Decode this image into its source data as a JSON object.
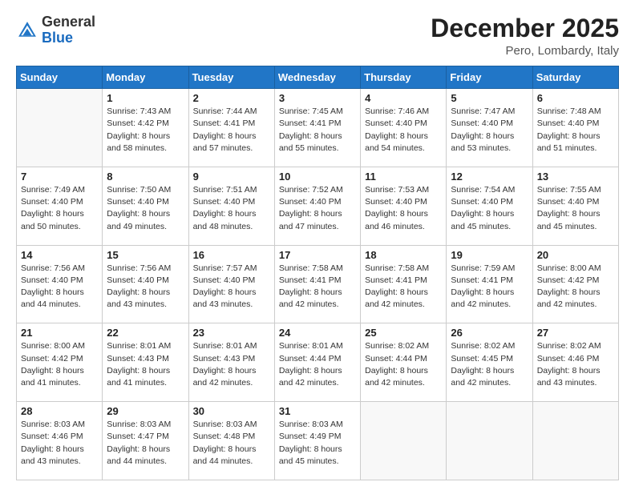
{
  "header": {
    "logo_general": "General",
    "logo_blue": "Blue",
    "month_title": "December 2025",
    "location": "Pero, Lombardy, Italy"
  },
  "weekdays": [
    "Sunday",
    "Monday",
    "Tuesday",
    "Wednesday",
    "Thursday",
    "Friday",
    "Saturday"
  ],
  "weeks": [
    [
      {
        "day": "",
        "sunrise": "",
        "sunset": "",
        "daylight": ""
      },
      {
        "day": "1",
        "sunrise": "Sunrise: 7:43 AM",
        "sunset": "Sunset: 4:42 PM",
        "daylight": "Daylight: 8 hours and 58 minutes."
      },
      {
        "day": "2",
        "sunrise": "Sunrise: 7:44 AM",
        "sunset": "Sunset: 4:41 PM",
        "daylight": "Daylight: 8 hours and 57 minutes."
      },
      {
        "day": "3",
        "sunrise": "Sunrise: 7:45 AM",
        "sunset": "Sunset: 4:41 PM",
        "daylight": "Daylight: 8 hours and 55 minutes."
      },
      {
        "day": "4",
        "sunrise": "Sunrise: 7:46 AM",
        "sunset": "Sunset: 4:40 PM",
        "daylight": "Daylight: 8 hours and 54 minutes."
      },
      {
        "day": "5",
        "sunrise": "Sunrise: 7:47 AM",
        "sunset": "Sunset: 4:40 PM",
        "daylight": "Daylight: 8 hours and 53 minutes."
      },
      {
        "day": "6",
        "sunrise": "Sunrise: 7:48 AM",
        "sunset": "Sunset: 4:40 PM",
        "daylight": "Daylight: 8 hours and 51 minutes."
      }
    ],
    [
      {
        "day": "7",
        "sunrise": "Sunrise: 7:49 AM",
        "sunset": "Sunset: 4:40 PM",
        "daylight": "Daylight: 8 hours and 50 minutes."
      },
      {
        "day": "8",
        "sunrise": "Sunrise: 7:50 AM",
        "sunset": "Sunset: 4:40 PM",
        "daylight": "Daylight: 8 hours and 49 minutes."
      },
      {
        "day": "9",
        "sunrise": "Sunrise: 7:51 AM",
        "sunset": "Sunset: 4:40 PM",
        "daylight": "Daylight: 8 hours and 48 minutes."
      },
      {
        "day": "10",
        "sunrise": "Sunrise: 7:52 AM",
        "sunset": "Sunset: 4:40 PM",
        "daylight": "Daylight: 8 hours and 47 minutes."
      },
      {
        "day": "11",
        "sunrise": "Sunrise: 7:53 AM",
        "sunset": "Sunset: 4:40 PM",
        "daylight": "Daylight: 8 hours and 46 minutes."
      },
      {
        "day": "12",
        "sunrise": "Sunrise: 7:54 AM",
        "sunset": "Sunset: 4:40 PM",
        "daylight": "Daylight: 8 hours and 45 minutes."
      },
      {
        "day": "13",
        "sunrise": "Sunrise: 7:55 AM",
        "sunset": "Sunset: 4:40 PM",
        "daylight": "Daylight: 8 hours and 45 minutes."
      }
    ],
    [
      {
        "day": "14",
        "sunrise": "Sunrise: 7:56 AM",
        "sunset": "Sunset: 4:40 PM",
        "daylight": "Daylight: 8 hours and 44 minutes."
      },
      {
        "day": "15",
        "sunrise": "Sunrise: 7:56 AM",
        "sunset": "Sunset: 4:40 PM",
        "daylight": "Daylight: 8 hours and 43 minutes."
      },
      {
        "day": "16",
        "sunrise": "Sunrise: 7:57 AM",
        "sunset": "Sunset: 4:40 PM",
        "daylight": "Daylight: 8 hours and 43 minutes."
      },
      {
        "day": "17",
        "sunrise": "Sunrise: 7:58 AM",
        "sunset": "Sunset: 4:41 PM",
        "daylight": "Daylight: 8 hours and 42 minutes."
      },
      {
        "day": "18",
        "sunrise": "Sunrise: 7:58 AM",
        "sunset": "Sunset: 4:41 PM",
        "daylight": "Daylight: 8 hours and 42 minutes."
      },
      {
        "day": "19",
        "sunrise": "Sunrise: 7:59 AM",
        "sunset": "Sunset: 4:41 PM",
        "daylight": "Daylight: 8 hours and 42 minutes."
      },
      {
        "day": "20",
        "sunrise": "Sunrise: 8:00 AM",
        "sunset": "Sunset: 4:42 PM",
        "daylight": "Daylight: 8 hours and 42 minutes."
      }
    ],
    [
      {
        "day": "21",
        "sunrise": "Sunrise: 8:00 AM",
        "sunset": "Sunset: 4:42 PM",
        "daylight": "Daylight: 8 hours and 41 minutes."
      },
      {
        "day": "22",
        "sunrise": "Sunrise: 8:01 AM",
        "sunset": "Sunset: 4:43 PM",
        "daylight": "Daylight: 8 hours and 41 minutes."
      },
      {
        "day": "23",
        "sunrise": "Sunrise: 8:01 AM",
        "sunset": "Sunset: 4:43 PM",
        "daylight": "Daylight: 8 hours and 42 minutes."
      },
      {
        "day": "24",
        "sunrise": "Sunrise: 8:01 AM",
        "sunset": "Sunset: 4:44 PM",
        "daylight": "Daylight: 8 hours and 42 minutes."
      },
      {
        "day": "25",
        "sunrise": "Sunrise: 8:02 AM",
        "sunset": "Sunset: 4:44 PM",
        "daylight": "Daylight: 8 hours and 42 minutes."
      },
      {
        "day": "26",
        "sunrise": "Sunrise: 8:02 AM",
        "sunset": "Sunset: 4:45 PM",
        "daylight": "Daylight: 8 hours and 42 minutes."
      },
      {
        "day": "27",
        "sunrise": "Sunrise: 8:02 AM",
        "sunset": "Sunset: 4:46 PM",
        "daylight": "Daylight: 8 hours and 43 minutes."
      }
    ],
    [
      {
        "day": "28",
        "sunrise": "Sunrise: 8:03 AM",
        "sunset": "Sunset: 4:46 PM",
        "daylight": "Daylight: 8 hours and 43 minutes."
      },
      {
        "day": "29",
        "sunrise": "Sunrise: 8:03 AM",
        "sunset": "Sunset: 4:47 PM",
        "daylight": "Daylight: 8 hours and 44 minutes."
      },
      {
        "day": "30",
        "sunrise": "Sunrise: 8:03 AM",
        "sunset": "Sunset: 4:48 PM",
        "daylight": "Daylight: 8 hours and 44 minutes."
      },
      {
        "day": "31",
        "sunrise": "Sunrise: 8:03 AM",
        "sunset": "Sunset: 4:49 PM",
        "daylight": "Daylight: 8 hours and 45 minutes."
      },
      {
        "day": "",
        "sunrise": "",
        "sunset": "",
        "daylight": ""
      },
      {
        "day": "",
        "sunrise": "",
        "sunset": "",
        "daylight": ""
      },
      {
        "day": "",
        "sunrise": "",
        "sunset": "",
        "daylight": ""
      }
    ]
  ]
}
